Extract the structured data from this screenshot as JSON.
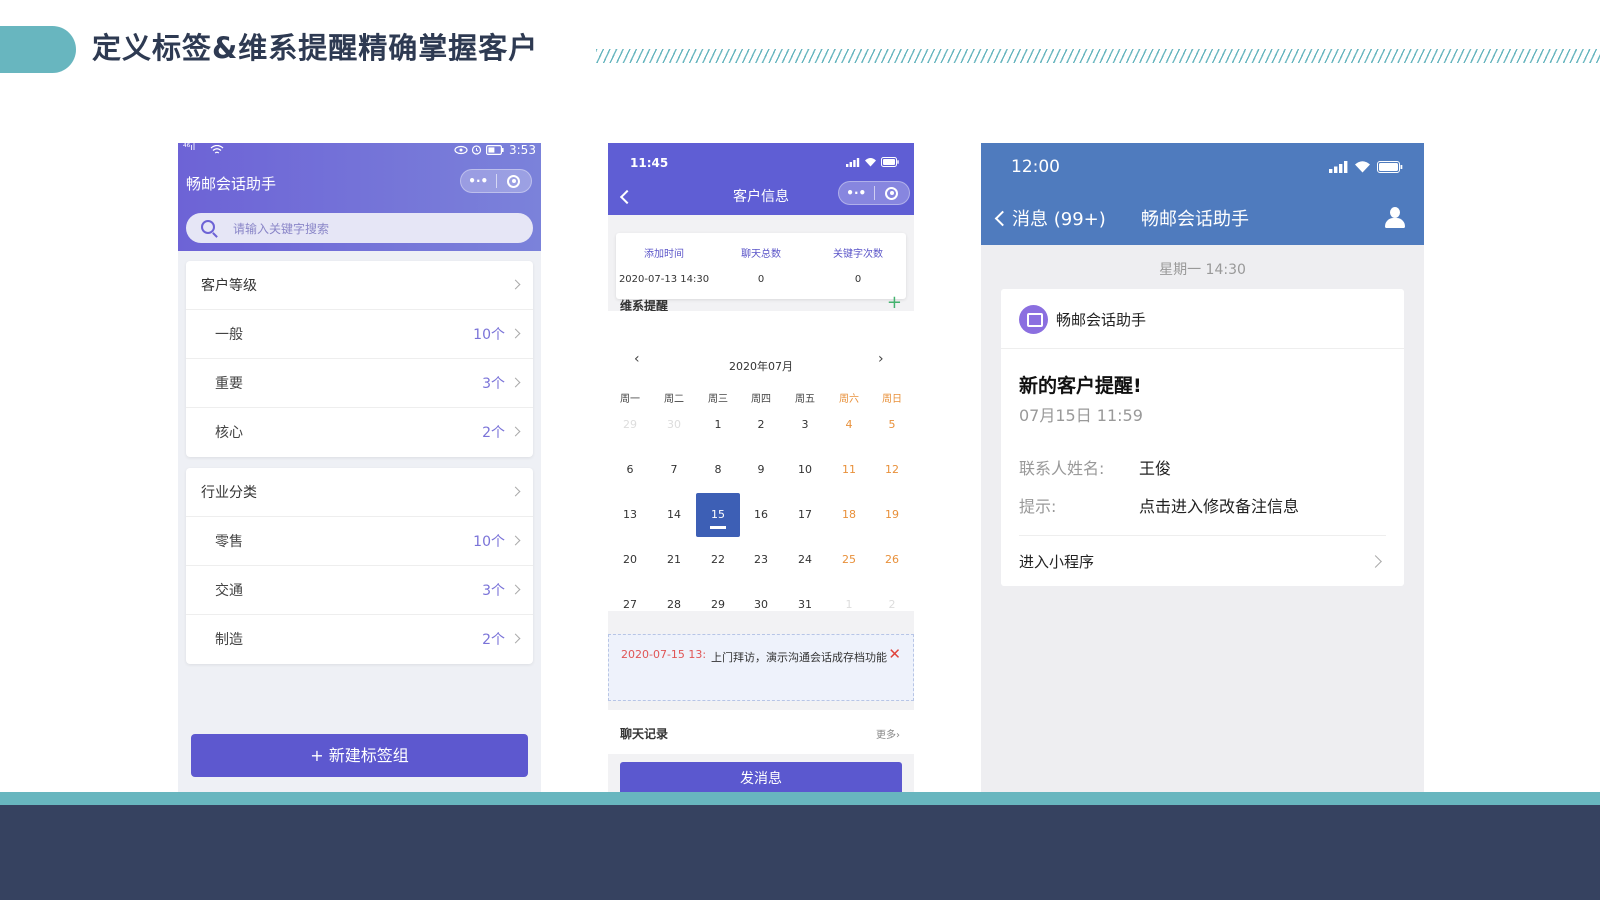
{
  "slide": {
    "title": "定义标签&维系提醒精确掌握客户",
    "colors": {
      "accent": "#68b6bf",
      "navy": "#364260"
    }
  },
  "phone1": {
    "status": {
      "network": "⁴⁶ıl",
      "time": "3:53"
    },
    "app_title": "畅邮会话助手",
    "capsule": {
      "more_icon": "•·•",
      "close_icon": "target-icon"
    },
    "search_placeholder": "请输入关键字搜索",
    "groups": [
      {
        "title": "客户等级",
        "items": [
          {
            "label": "一般",
            "count": "10个"
          },
          {
            "label": "重要",
            "count": "3个"
          },
          {
            "label": "核心",
            "count": "2个"
          }
        ]
      },
      {
        "title": "行业分类",
        "items": [
          {
            "label": "零售",
            "count": "10个"
          },
          {
            "label": "交通",
            "count": "3个"
          },
          {
            "label": "制造",
            "count": "2个"
          }
        ]
      }
    ],
    "new_button": "+ 新建标签组",
    "colors": {
      "header": "#6d63d6",
      "button": "#5d58cf"
    }
  },
  "phone2": {
    "status": {
      "time": "11:45"
    },
    "title": "客户信息",
    "stats": [
      {
        "label": "添加时间",
        "value": "2020-07-13 14:30"
      },
      {
        "label": "聊天总数",
        "value": "0"
      },
      {
        "label": "关键字次数",
        "value": "0"
      }
    ],
    "reminder_title": "维系提醒",
    "add_icon": "+",
    "calendar": {
      "prev": "‹",
      "next": "›",
      "month": "2020年07月",
      "weekdays": [
        "周一",
        "周二",
        "周三",
        "周四",
        "周五",
        "周六",
        "周日"
      ],
      "weeks": [
        [
          "29",
          "30",
          "1",
          "2",
          "3",
          "4",
          "5"
        ],
        [
          "6",
          "7",
          "8",
          "9",
          "10",
          "11",
          "12"
        ],
        [
          "13",
          "14",
          "15",
          "16",
          "17",
          "18",
          "19"
        ],
        [
          "20",
          "21",
          "22",
          "23",
          "24",
          "25",
          "26"
        ],
        [
          "27",
          "28",
          "29",
          "30",
          "31",
          "1",
          "2"
        ]
      ],
      "selected": "15"
    },
    "note": {
      "time": "2020-07-15 13:",
      "text": "上门拜访，演示沟通会话成存档功能",
      "close_icon": "✕"
    },
    "chat_label": "聊天记录",
    "more": "更多›",
    "send_button": "发消息",
    "colors": {
      "header": "#5f5ed4",
      "selected_day": "#3d5fb5",
      "weekend": "#e8903a",
      "note_time": "#e05555"
    }
  },
  "phone3": {
    "status": {
      "time": "12:00"
    },
    "back_label": "消息 (99+)",
    "title": "畅邮会话助手",
    "timestamp": "星期一 14:30",
    "message": {
      "source": "畅邮会话助手",
      "heading": "新的客户提醒!",
      "datetime": "07月15日 11:59",
      "fields": [
        {
          "key": "联系人姓名:",
          "value": "王俊"
        },
        {
          "key": "提示:",
          "value": "点击进入修改备注信息"
        }
      ],
      "action": "进入小程序"
    },
    "colors": {
      "header": "#4f7bbe"
    }
  }
}
